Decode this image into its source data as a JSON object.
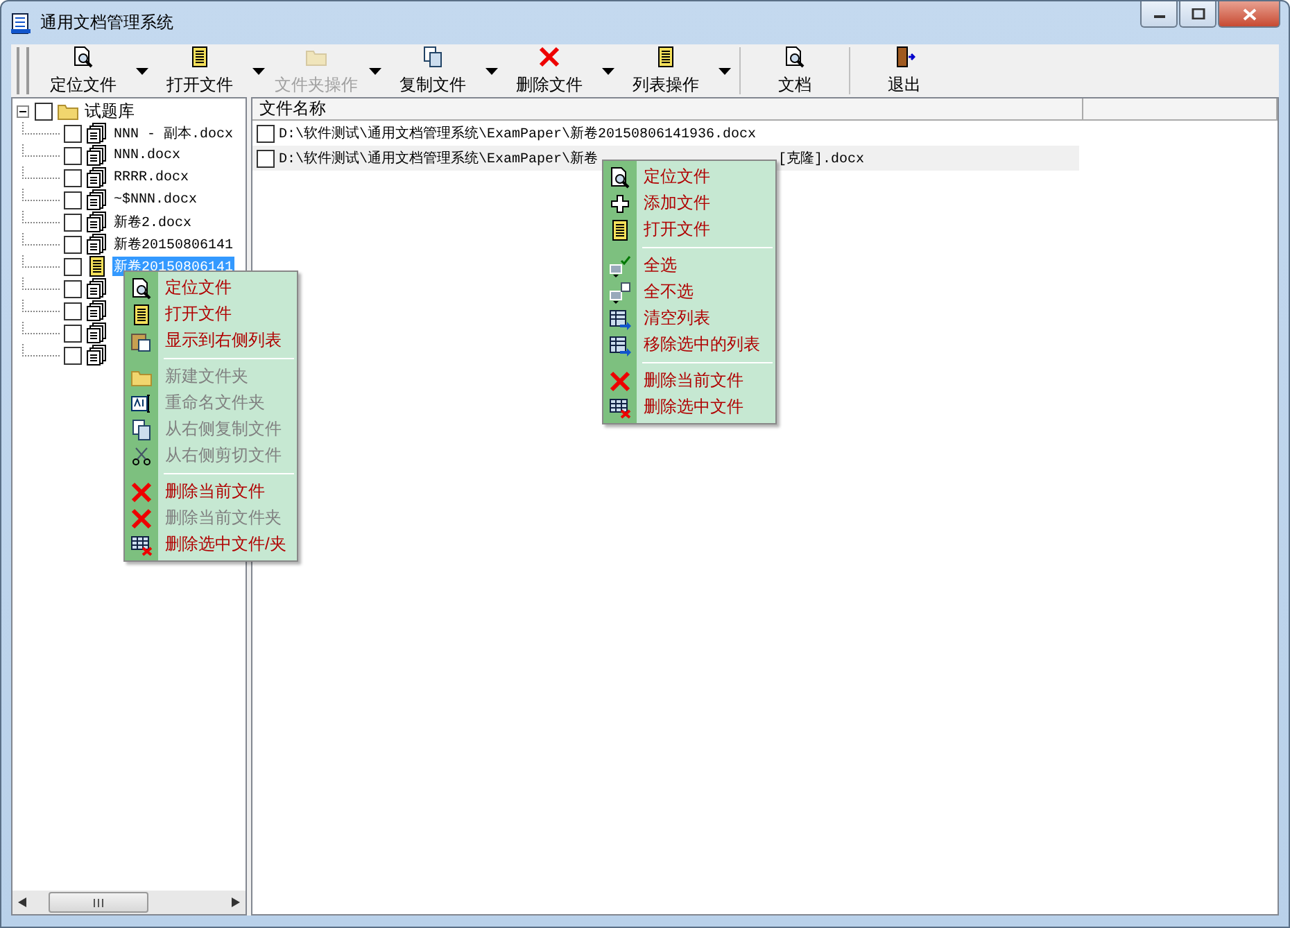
{
  "window": {
    "title": "通用文档管理系统"
  },
  "toolbar": [
    {
      "label": "定位文件",
      "disabled": false,
      "dropdown": true
    },
    {
      "label": "打开文件",
      "disabled": false,
      "dropdown": true
    },
    {
      "label": "文件夹操作",
      "disabled": true,
      "dropdown": true
    },
    {
      "label": "复制文件",
      "disabled": false,
      "dropdown": true
    },
    {
      "label": "删除文件",
      "disabled": false,
      "dropdown": true
    },
    {
      "label": "列表操作",
      "disabled": false,
      "dropdown": true
    },
    {
      "label": "文档",
      "disabled": false,
      "dropdown": false
    },
    {
      "label": "退出",
      "disabled": false,
      "dropdown": false
    }
  ],
  "tree": {
    "label": "试题库",
    "expanded": true,
    "checked": false,
    "children": [
      {
        "label": "NNN - 副本.docx",
        "checked": false,
        "selected": false
      },
      {
        "label": "NNN.docx",
        "checked": false,
        "selected": false
      },
      {
        "label": "RRRR.docx",
        "checked": false,
        "selected": false
      },
      {
        "label": "~$NNN.docx",
        "checked": false,
        "selected": false
      },
      {
        "label": "新卷2.docx",
        "checked": false,
        "selected": false
      },
      {
        "label": "新卷20150806141",
        "checked": false,
        "selected": false
      },
      {
        "label": "新卷20150806141",
        "checked": false,
        "selected": true
      },
      {
        "checked": false
      },
      {
        "checked": false
      },
      {
        "checked": false
      },
      {
        "checked": false
      }
    ]
  },
  "tree_menu": {
    "sections": [
      [
        {
          "label": "定位文件",
          "disabled": false
        },
        {
          "label": "打开文件",
          "disabled": false
        },
        {
          "label": "显示到右侧列表",
          "disabled": false
        }
      ],
      [
        {
          "label": "新建文件夹",
          "disabled": true
        },
        {
          "label": "重命名文件夹",
          "disabled": true
        },
        {
          "label": "从右侧复制文件",
          "disabled": true
        },
        {
          "label": "从右侧剪切文件",
          "disabled": true
        }
      ],
      [
        {
          "label": "删除当前文件",
          "disabled": false
        },
        {
          "label": "删除当前文件夹",
          "disabled": true
        },
        {
          "label": "删除选中文件/夹",
          "disabled": false
        }
      ]
    ]
  },
  "file_list": {
    "columns": [
      "文件名称"
    ],
    "rows": [
      {
        "path": "D:\\软件测试\\通用文档管理系统\\ExamPaper\\新卷20150806141936.docx",
        "checked": false,
        "selected": false
      },
      {
        "path": "D:\\软件测试\\通用文档管理系统\\ExamPaper\\新卷",
        "path_end": "[克隆].docx",
        "checked": false,
        "selected": true
      }
    ]
  },
  "list_menu": {
    "sections": [
      [
        {
          "label": "定位文件",
          "disabled": false
        },
        {
          "label": "添加文件",
          "disabled": false
        },
        {
          "label": "打开文件",
          "disabled": false
        }
      ],
      [
        {
          "label": "全选",
          "disabled": false
        },
        {
          "label": "全不选",
          "disabled": false
        },
        {
          "label": "清空列表",
          "disabled": false
        },
        {
          "label": "移除选中的列表",
          "disabled": false
        }
      ],
      [
        {
          "label": "删除当前文件",
          "disabled": false
        },
        {
          "label": "删除选中文件",
          "disabled": false
        }
      ]
    ]
  }
}
